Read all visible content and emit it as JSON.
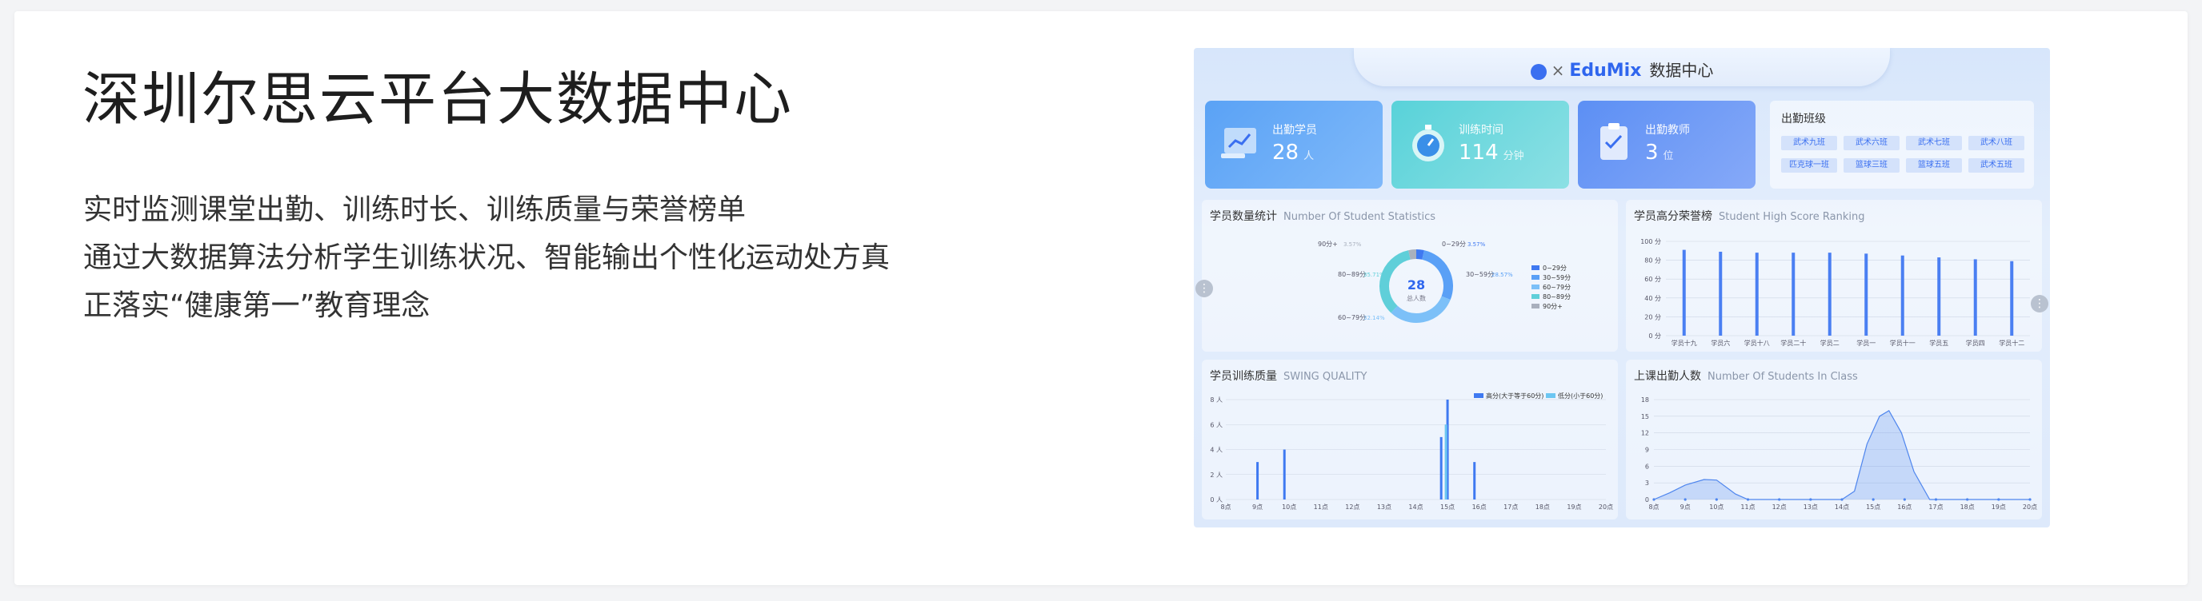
{
  "hero": {
    "title": "深圳尔思云平台大数据中心",
    "lines": [
      "实时监测课堂出勤、训练时长、训练质量与荣誉榜单",
      "通过大数据算法分析学生训练状况、智能输出个性化运动处方真",
      "正落实“健康第一”教育理念"
    ]
  },
  "dashboard": {
    "brand_x": "×",
    "brand_name": "EduMix",
    "brand_title": "数据中心",
    "stats": [
      {
        "label": "出勤学员",
        "value": "28",
        "unit": "人",
        "color_from": "#5aa2f5",
        "color_to": "#7fb9fa",
        "icon": "chart-board-icon"
      },
      {
        "label": "训练时间",
        "value": "114",
        "unit": "分钟",
        "color_from": "#58d2d9",
        "color_to": "#8ce0e4",
        "icon": "stopwatch-icon"
      },
      {
        "label": "出勤教师",
        "value": "3",
        "unit": "位",
        "color_from": "#5c8ff4",
        "color_to": "#86a9f8",
        "icon": "clipboard-icon"
      }
    ],
    "classes": {
      "title": "出勤班级",
      "items": [
        "武术九班",
        "武术六班",
        "武术七班",
        "武术八班",
        "匹克球一班",
        "篮球三班",
        "篮球五班",
        "武术五班"
      ]
    },
    "panels": {
      "student_stats": {
        "title": "学员数量统计",
        "subtitle": "Number Of Student Statistics"
      },
      "ranking": {
        "title": "学员高分荣誉榜",
        "subtitle": "Student High Score Ranking"
      },
      "swing": {
        "title": "学员训练质量",
        "subtitle": "SWING QUALITY"
      },
      "attendance": {
        "title": "上课出勤人数",
        "subtitle": "Number Of Students In Class"
      }
    },
    "side_icon": "more-vertical-icon"
  },
  "chart_data": [
    {
      "type": "pie",
      "title": "学员数量统计",
      "center_value": "28",
      "center_label": "总人数",
      "slices": [
        {
          "name": "0~29分",
          "value": 3.57,
          "color": "#3f79f1"
        },
        {
          "name": "30~59分",
          "value": 28.57,
          "color": "#5aa0f6"
        },
        {
          "name": "60~79分",
          "value": 32.14,
          "color": "#7cc0f8"
        },
        {
          "name": "80~89分",
          "value": 35.71,
          "color": "#5fcfd9"
        },
        {
          "name": "90分+",
          "value": 3.57,
          "color": "#a9b0bd"
        }
      ],
      "labels": [
        {
          "text": "0~29分",
          "pct": "3.57%"
        },
        {
          "text": "30~59分",
          "pct": "28.57%"
        },
        {
          "text": "60~79分",
          "pct": "32.14%"
        },
        {
          "text": "80~89分",
          "pct": "35.71%"
        },
        {
          "text": "90分+",
          "pct": "3.57%"
        }
      ],
      "legend": [
        "0~29分",
        "30~59分",
        "60~79分",
        "80~89分",
        "90分+"
      ]
    },
    {
      "type": "bar",
      "title": "学员高分荣誉榜",
      "categories": [
        "学员十九",
        "学员六",
        "学员十八",
        "学员二十",
        "学员二",
        "学员一",
        "学员十一",
        "学员五",
        "学员四",
        "学员十二"
      ],
      "values": [
        91,
        89,
        88,
        88,
        88,
        87,
        85,
        83,
        81,
        79
      ],
      "yticks": [
        "100 分",
        "80 分",
        "60 分",
        "40 分",
        "20 分",
        "0 分"
      ],
      "ylim": [
        0,
        100
      ],
      "color": "#4a7ff2"
    },
    {
      "type": "bar",
      "title": "学员训练质量",
      "x": [
        "8点",
        "9点",
        "10点",
        "11点",
        "12点",
        "13点",
        "14点",
        "15点",
        "16点",
        "17点",
        "18点",
        "19点",
        "20点"
      ],
      "yticks": [
        "8 人",
        "6 人",
        "4 人",
        "2 人",
        "0 人"
      ],
      "ylim": [
        0,
        8
      ],
      "series": [
        {
          "name": "高分(大于等于60分)",
          "color": "#3f79f1",
          "points": [
            [
              9.0,
              3
            ],
            [
              9.85,
              4
            ],
            [
              14.8,
              5
            ],
            [
              15.0,
              8
            ],
            [
              15.85,
              3
            ]
          ]
        },
        {
          "name": "低分(小于60分)",
          "color": "#6cc6f2",
          "points": [
            [
              14.95,
              6
            ]
          ]
        }
      ],
      "legend": [
        "高分(大于等于60分)",
        "低分(小于60分)"
      ]
    },
    {
      "type": "area",
      "title": "上课出勤人数",
      "x": [
        "8点",
        "9点",
        "10点",
        "11点",
        "12点",
        "13点",
        "14点",
        "15点",
        "16点",
        "17点",
        "18点",
        "19点",
        "20点"
      ],
      "yticks": [
        "18",
        "15",
        "12",
        "9",
        "6",
        "3",
        "0"
      ],
      "ylim": [
        0,
        18
      ],
      "points": [
        [
          8,
          0
        ],
        [
          8.5,
          1.2
        ],
        [
          9,
          2.6
        ],
        [
          9.6,
          3.6
        ],
        [
          10,
          3.5
        ],
        [
          10.6,
          1
        ],
        [
          11,
          0
        ],
        [
          14,
          0
        ],
        [
          14.4,
          1.5
        ],
        [
          14.8,
          10
        ],
        [
          15.2,
          15
        ],
        [
          15.5,
          16
        ],
        [
          15.9,
          12
        ],
        [
          16.3,
          5
        ],
        [
          16.8,
          0
        ],
        [
          20,
          0
        ]
      ],
      "color": "#4f86ee"
    }
  ]
}
